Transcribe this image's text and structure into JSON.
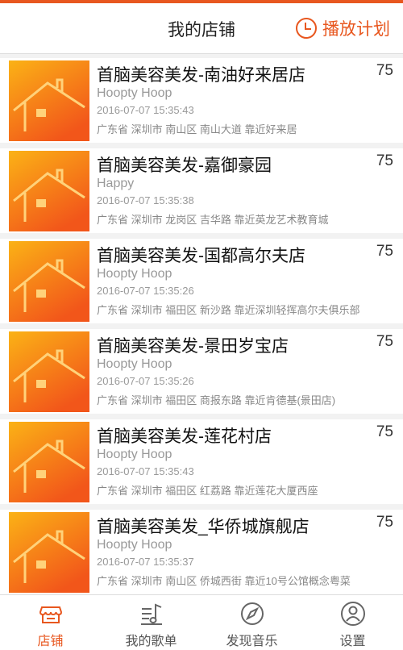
{
  "header": {
    "title": "我的店铺",
    "play_plan_label": "播放计划"
  },
  "colors": {
    "accent": "#e8571f",
    "thumb_gradient_top": "#fbb216",
    "thumb_gradient_bottom": "#f2561a"
  },
  "stores": [
    {
      "name": "首脑美容美发-南油好来居店",
      "count": "75",
      "music": "Hoopty Hoop",
      "time": "2016-07-07 15:35:43",
      "address": "广东省 深圳市 南山区 南山大道 靠近好来居"
    },
    {
      "name": "首脑美容美发-嘉御豪园",
      "count": "75",
      "music": "Happy",
      "time": "2016-07-07 15:35:38",
      "address": "广东省 深圳市 龙岗区 吉华路 靠近英龙艺术教育城"
    },
    {
      "name": "首脑美容美发-国都高尔夫店",
      "count": "75",
      "music": "Hoopty Hoop",
      "time": "2016-07-07 15:35:26",
      "address": "广东省 深圳市 福田区 新沙路 靠近深圳轻挥高尔夫俱乐部"
    },
    {
      "name": "首脑美容美发-景田岁宝店",
      "count": "75",
      "music": "Hoopty Hoop",
      "time": "2016-07-07 15:35:26",
      "address": "广东省 深圳市 福田区 商报东路 靠近肯德基(景田店)"
    },
    {
      "name": "首脑美容美发-莲花村店",
      "count": "75",
      "music": "Hoopty Hoop",
      "time": "2016-07-07 15:35:43",
      "address": "广东省 深圳市 福田区 红荔路 靠近莲花大厦西座"
    },
    {
      "name": "首脑美容美发_华侨城旗舰店",
      "count": "75",
      "music": "Hoopty Hoop",
      "time": "2016-07-07 15:35:37",
      "address": "广东省 深圳市 南山区 侨城西街 靠近10号公馆概念粤菜"
    }
  ],
  "tabs": [
    {
      "label": "店铺",
      "icon": "store-icon",
      "active": true
    },
    {
      "label": "我的歌单",
      "icon": "playlist-icon",
      "active": false
    },
    {
      "label": "发现音乐",
      "icon": "compass-icon",
      "active": false
    },
    {
      "label": "设置",
      "icon": "user-settings-icon",
      "active": false
    }
  ]
}
